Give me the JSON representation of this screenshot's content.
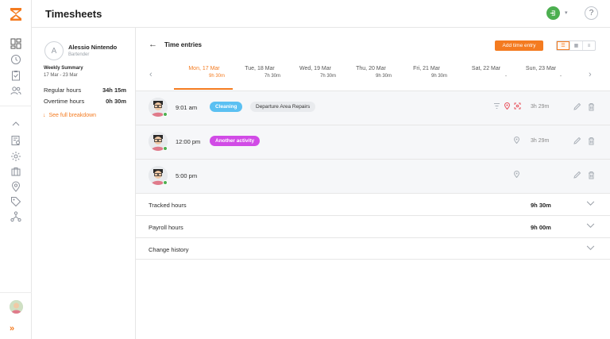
{
  "app": {
    "title": "Timesheets"
  },
  "rail": {
    "icons": [
      "dashboard-icon",
      "clock-icon",
      "clipboard-icon",
      "people-icon",
      "collapse-up-icon",
      "report-icon",
      "settings-icon",
      "briefcase-icon",
      "location-icon",
      "tag-icon",
      "network-icon"
    ],
    "expand_label": "»"
  },
  "topbar": {
    "help_label": "?"
  },
  "summary": {
    "avatar_initial": "A",
    "name": "Alessio Nintendo",
    "role": "Bartender",
    "weekly_title": "Weekly Summary",
    "weekly_range": "17 Mar - 23 Mar",
    "regular_label": "Regular hours",
    "regular_value": "34h 15m",
    "overtime_label": "Overtime hours",
    "overtime_value": "0h 30m",
    "breakdown_label": "See full breakdown"
  },
  "main": {
    "title": "Time entries",
    "add_label": "Add time entry",
    "days": [
      {
        "label": "Mon, 17 Mar",
        "hours": "9h 30m",
        "active": true
      },
      {
        "label": "Tue, 18 Mar",
        "hours": "7h 30m",
        "active": false
      },
      {
        "label": "Wed, 19 Mar",
        "hours": "7h 30m",
        "active": false
      },
      {
        "label": "Thu, 20 Mar",
        "hours": "9h 30m",
        "active": false
      },
      {
        "label": "Fri, 21 Mar",
        "hours": "9h 30m",
        "active": false
      },
      {
        "label": "Sat, 22 Mar",
        "hours": "-",
        "active": false
      },
      {
        "label": "Sun, 23 Mar",
        "hours": "-",
        "active": false
      }
    ],
    "entries": [
      {
        "time": "9:01 am",
        "activity": "Cleaning",
        "activity_color": "#5bc0f2",
        "job": "Departure Area Repairs",
        "duration": "3h 29m"
      },
      {
        "time": "12:00 pm",
        "activity": "Another activity",
        "activity_color": "#d14be6",
        "job": "",
        "duration": "3h 29m"
      },
      {
        "time": "5:00 pm",
        "activity": "",
        "activity_color": "",
        "job": "",
        "duration": ""
      }
    ],
    "tracked_label": "Tracked hours",
    "tracked_value": "9h 30m",
    "payroll_label": "Payroll hours",
    "payroll_value": "9h 00m",
    "history_label": "Change history"
  },
  "colors": {
    "accent": "#f47b20",
    "online": "#4caf50"
  }
}
